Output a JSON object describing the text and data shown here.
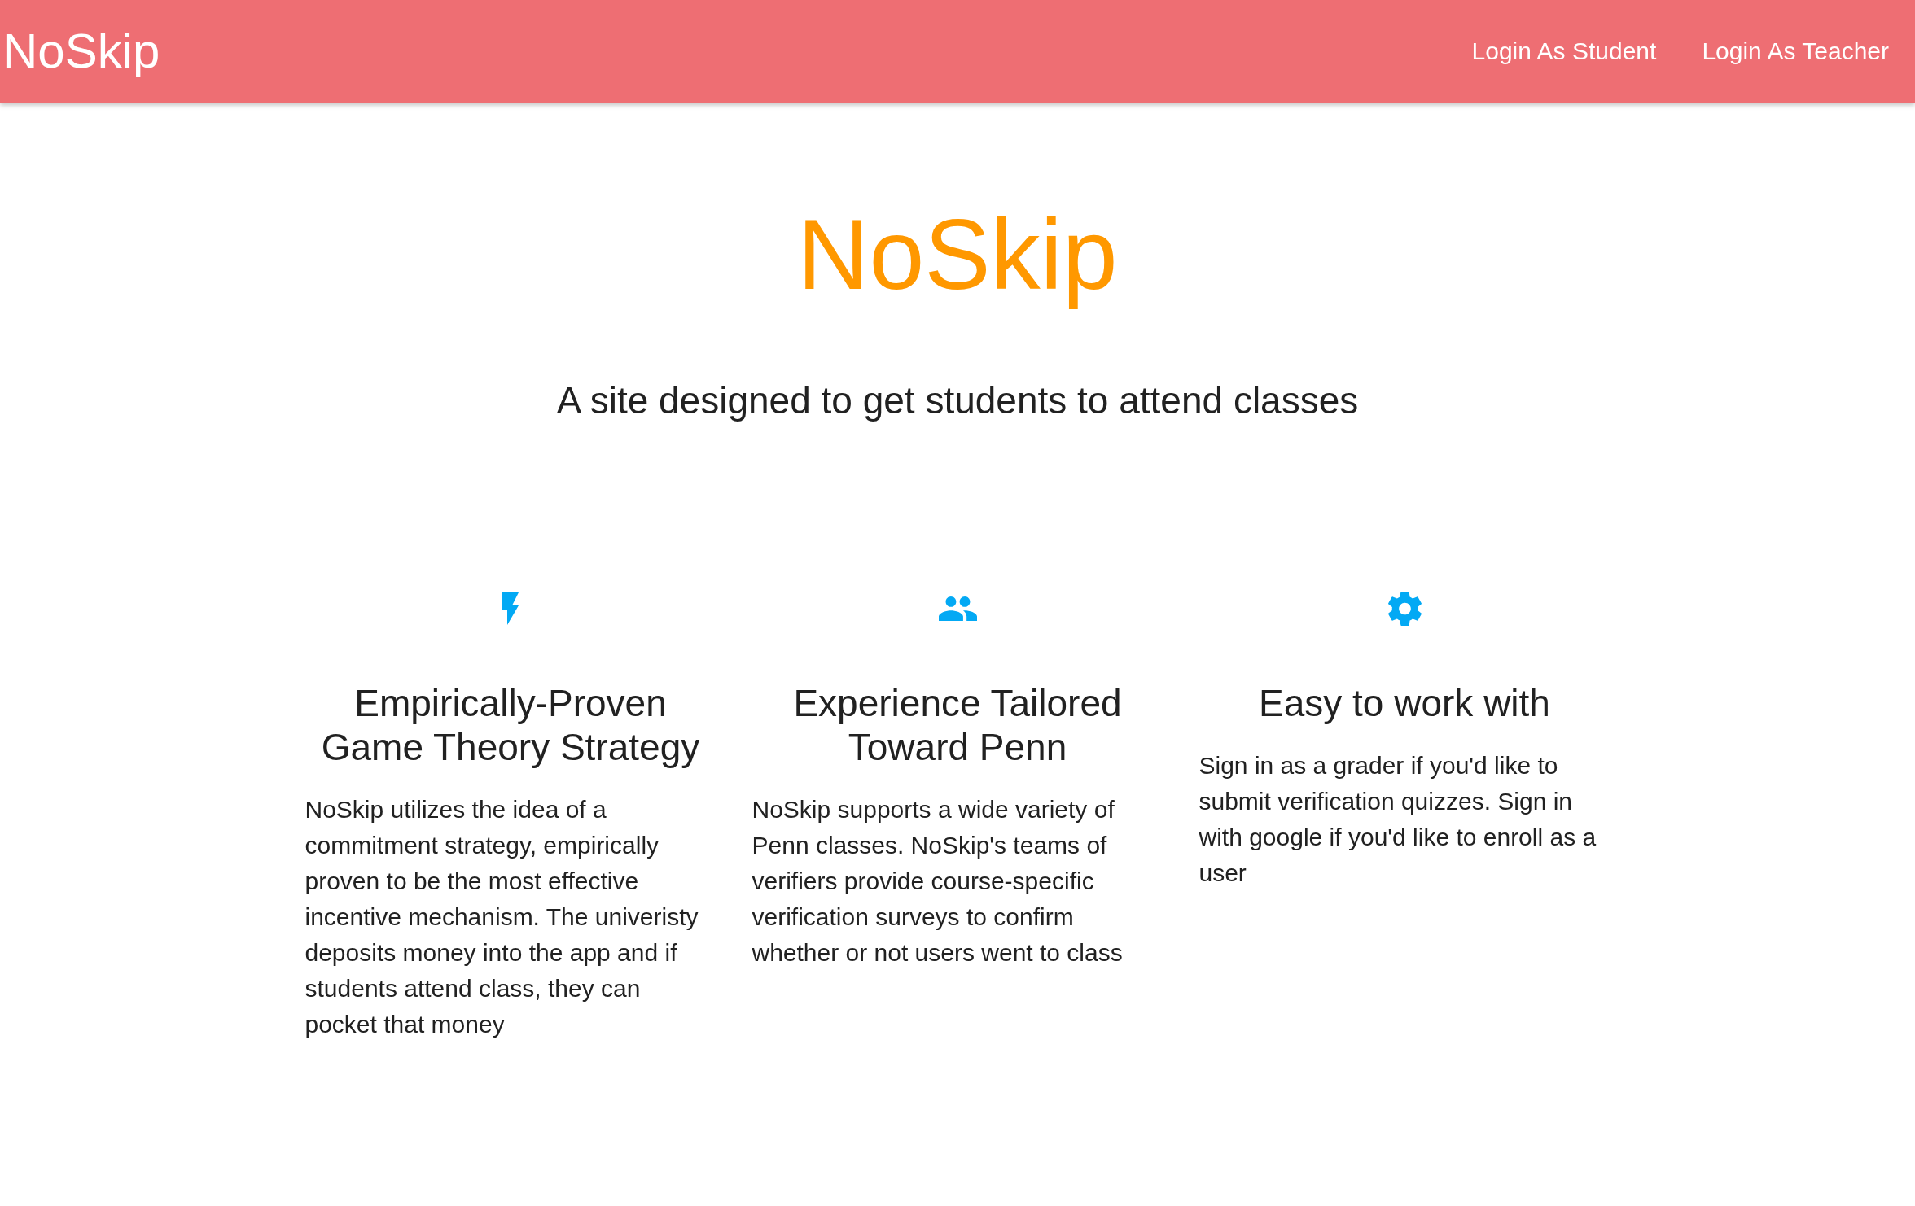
{
  "navbar": {
    "logo": "NoSkip",
    "links": [
      "Login As Student",
      "Login As Teacher"
    ]
  },
  "hero": {
    "title": "NoSkip",
    "subtitle": "A site designed to get students to attend classes"
  },
  "features": [
    {
      "kind": "bolt",
      "title": "Empirically-Proven Game Theory Strategy",
      "text": "NoSkip utilizes the idea of a commitment strategy, empirically proven to be the most effective incentive mechanism. The univeristy deposits money into the app and if students attend class, they can pocket that money"
    },
    {
      "kind": "people",
      "title": "Experience Tailored Toward Penn",
      "text": "NoSkip supports a wide variety of Penn classes. NoSkip's teams of verifiers provide course-specific verification surveys to confirm whether or not users went to class"
    },
    {
      "kind": "gear",
      "title": "Easy to work with",
      "text": "Sign in as a grader if you'd like to submit verification quizzes. Sign in with google if you'd like to enroll as a user"
    }
  ]
}
